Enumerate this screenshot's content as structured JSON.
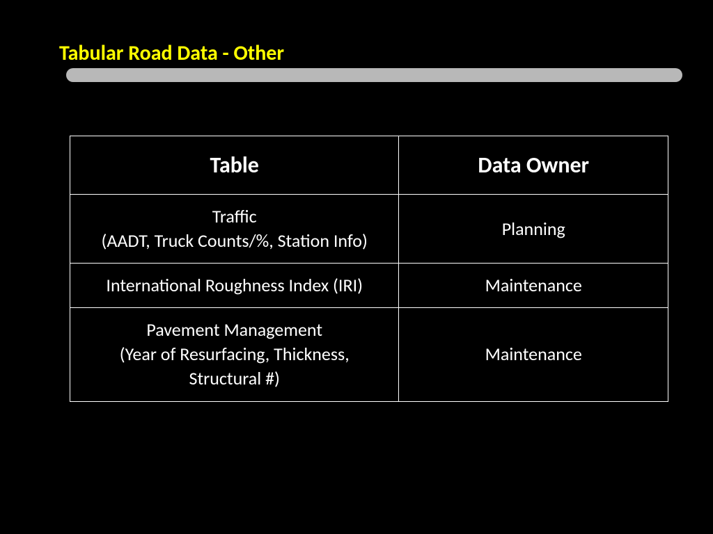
{
  "header": {
    "title": "Tabular Road Data - Other"
  },
  "table": {
    "headers": [
      "Table",
      "Data Owner"
    ],
    "rows": [
      {
        "table_lines": [
          "Traffic",
          "(AADT, Truck Counts/%, Station Info)"
        ],
        "owner": "Planning"
      },
      {
        "table_lines": [
          "International Roughness Index (IRI)"
        ],
        "owner": "Maintenance"
      },
      {
        "table_lines": [
          "Pavement Management",
          "(Year of Resurfacing, Thickness,",
          "Structural #)"
        ],
        "owner": "Maintenance"
      }
    ]
  },
  "chart_data": {
    "type": "table",
    "title": "Tabular Road Data - Other",
    "headers": [
      "Table",
      "Data Owner"
    ],
    "rows": [
      [
        "Traffic (AADT, Truck Counts/%, Station Info)",
        "Planning"
      ],
      [
        "International Roughness Index (IRI)",
        "Maintenance"
      ],
      [
        "Pavement Management (Year of Resurfacing, Thickness, Structural #)",
        "Maintenance"
      ]
    ]
  }
}
